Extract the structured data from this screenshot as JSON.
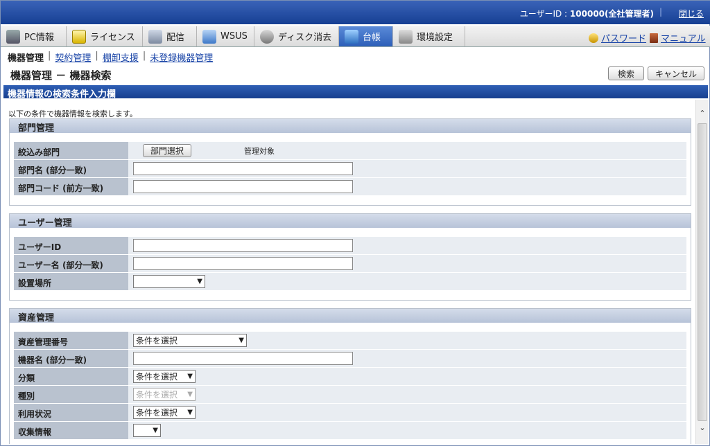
{
  "header": {
    "user_label": "ユーザーID : ",
    "user_value": "100000(全社管理者)",
    "close_label": "閉じる"
  },
  "tabs": [
    {
      "label": "PC情報",
      "icon": "pc-icon"
    },
    {
      "label": "ライセンス",
      "icon": "license-icon"
    },
    {
      "label": "配信",
      "icon": "distribution-icon"
    },
    {
      "label": "WSUS",
      "icon": "wsus-icon"
    },
    {
      "label": "ディスク消去",
      "icon": "disk-erase-icon"
    },
    {
      "label": "台帳",
      "icon": "ledger-icon"
    },
    {
      "label": "環境設定",
      "icon": "settings-icon"
    }
  ],
  "tab_right": {
    "password": "パスワード",
    "manual": "マニュアル"
  },
  "subnav": {
    "current": "機器管理",
    "items": [
      "契約管理",
      "棚卸支援",
      "未登録機器管理"
    ]
  },
  "page": {
    "title": "機器管理 － 機器検索",
    "search_button": "検索",
    "cancel_button": "キャンセル",
    "section_title": "機器情報の検索条件入力欄",
    "intro": "以下の条件で機器情報を検索します。"
  },
  "dept": {
    "title": "部門管理",
    "rows": [
      {
        "label": "絞込み部門",
        "button": "部門選択",
        "note": "管理対象"
      },
      {
        "label": "部門名 (部分一致)"
      },
      {
        "label": "部門コード (前方一致)"
      }
    ]
  },
  "user": {
    "title": "ユーザー管理",
    "rows": [
      {
        "label": "ユーザーID"
      },
      {
        "label": "ユーザー名 (部分一致)"
      },
      {
        "label": "設置場所"
      }
    ]
  },
  "asset": {
    "title": "資産管理",
    "rows": [
      {
        "label": "資産管理番号",
        "select": "条件を選択"
      },
      {
        "label": "機器名 (部分一致)"
      },
      {
        "label": "分類",
        "select": "条件を選択"
      },
      {
        "label": "種別",
        "select": "条件を選択"
      },
      {
        "label": "利用状況",
        "select": "条件を選択"
      },
      {
        "label": "収集情報"
      }
    ]
  },
  "icons": {
    "chevron": "chevron-down-icon",
    "scroll_up": "scroll-up-icon",
    "scroll_down": "scroll-down-icon"
  }
}
